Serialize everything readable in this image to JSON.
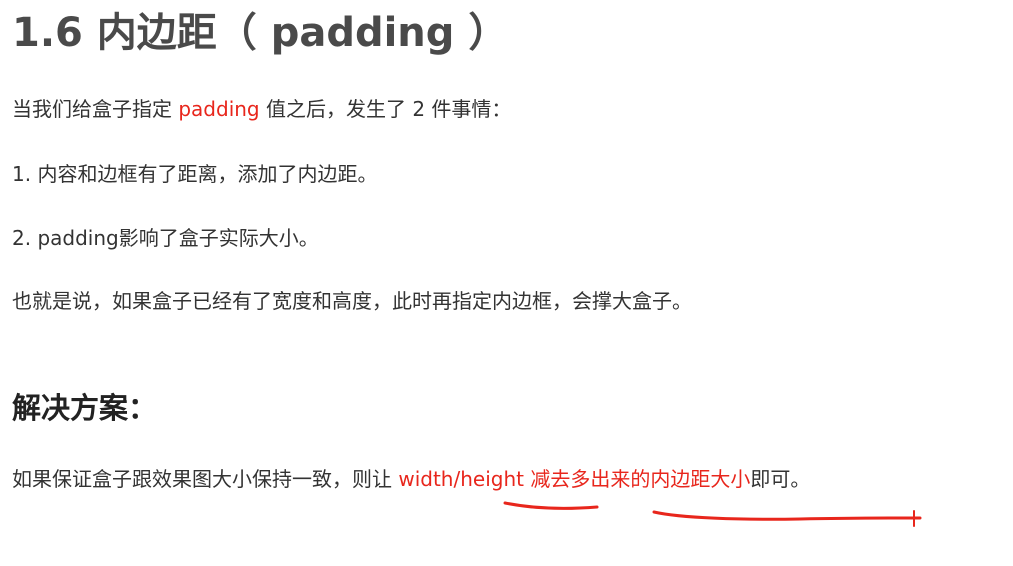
{
  "heading": {
    "title": "1.6 内边距（ padding ）"
  },
  "paragraphs": {
    "intro_before": "当我们给盒子指定 ",
    "intro_highlight": "padding",
    "intro_after": " 值之后，发生了 2 件事情：",
    "item1": "1. 内容和边框有了距离，添加了内边距。",
    "item2": "2. padding影响了盒子实际大小。",
    "summary": "也就是说，如果盒子已经有了宽度和高度，此时再指定内边框，会撑大盒子。"
  },
  "solution": {
    "heading": "解决方案：",
    "text_before": "如果保证盒子跟效果图大小保持一致，则让 ",
    "highlight_code": "width/height",
    "highlight_text": " 减去多出来的内边距大小",
    "text_after": "即可。"
  },
  "colors": {
    "highlight": "#e8261c",
    "annotation_stroke": "#e8261c",
    "body_text": "#333333",
    "title_text": "#4a4a4a"
  }
}
